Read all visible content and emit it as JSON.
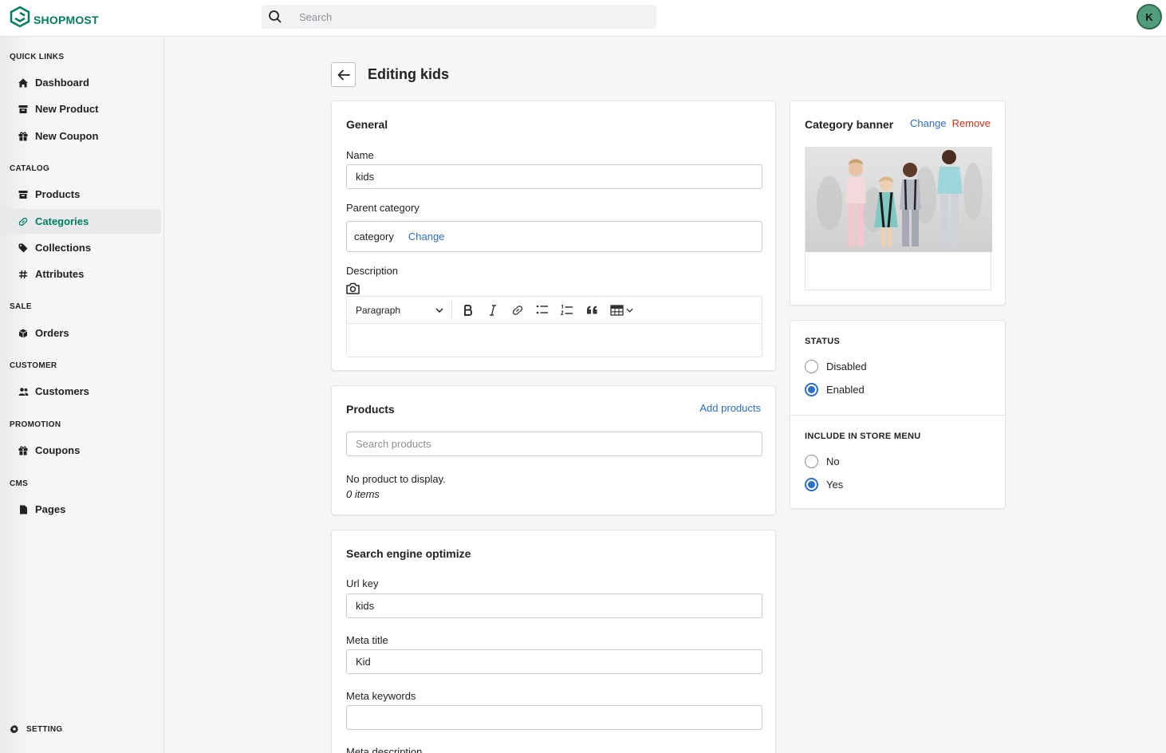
{
  "brand": {
    "name": "SHOPMOST",
    "color": "#008060"
  },
  "header": {
    "search_placeholder": "Search",
    "avatar_initial": "K"
  },
  "sidebar": {
    "sections": [
      {
        "title": "QUICK LINKS",
        "items": [
          {
            "label": "Dashboard",
            "icon": "home-icon"
          },
          {
            "label": "New Product",
            "icon": "archive-icon"
          },
          {
            "label": "New Coupon",
            "icon": "gift-icon"
          }
        ]
      },
      {
        "title": "CATALOG",
        "items": [
          {
            "label": "Products",
            "icon": "archive-icon"
          },
          {
            "label": "Categories",
            "icon": "link-icon",
            "active": true
          },
          {
            "label": "Collections",
            "icon": "tag-icon"
          },
          {
            "label": "Attributes",
            "icon": "hash-icon"
          }
        ]
      },
      {
        "title": "SALE",
        "items": [
          {
            "label": "Orders",
            "icon": "cube-icon"
          }
        ]
      },
      {
        "title": "CUSTOMER",
        "items": [
          {
            "label": "Customers",
            "icon": "users-icon"
          }
        ]
      },
      {
        "title": "PROMOTION",
        "items": [
          {
            "label": "Coupons",
            "icon": "gift-icon"
          }
        ]
      },
      {
        "title": "CMS",
        "items": [
          {
            "label": "Pages",
            "icon": "document-icon"
          }
        ]
      }
    ],
    "setting_label": "SETTING"
  },
  "page": {
    "title": "Editing kids"
  },
  "general": {
    "title": "General",
    "name_label": "Name",
    "name_value": "kids",
    "parent_label": "Parent category",
    "parent_value": "category",
    "parent_change": "Change",
    "description_label": "Description",
    "toolbar_block": "Paragraph"
  },
  "products": {
    "title": "Products",
    "add_link": "Add products",
    "search_placeholder": "Search products",
    "empty_text": "No product to display.",
    "count_text": "0 items"
  },
  "seo": {
    "title": "Search engine optimize",
    "url_key_label": "Url key",
    "url_key_value": "kids",
    "meta_title_label": "Meta title",
    "meta_title_value": "Kid",
    "meta_keywords_label": "Meta keywords",
    "meta_keywords_value": "",
    "meta_description_label": "Meta description"
  },
  "banner": {
    "title": "Category banner",
    "change": "Change",
    "remove": "Remove",
    "remove_color": "#d82c0d"
  },
  "status": {
    "title": "STATUS",
    "options": [
      "Disabled",
      "Enabled"
    ],
    "selected": "Enabled"
  },
  "store_menu": {
    "title": "INCLUDE IN STORE MENU",
    "options": [
      "No",
      "Yes"
    ],
    "selected": "Yes"
  },
  "colors": {
    "accent": "#2c6ecb",
    "brand": "#008060"
  }
}
